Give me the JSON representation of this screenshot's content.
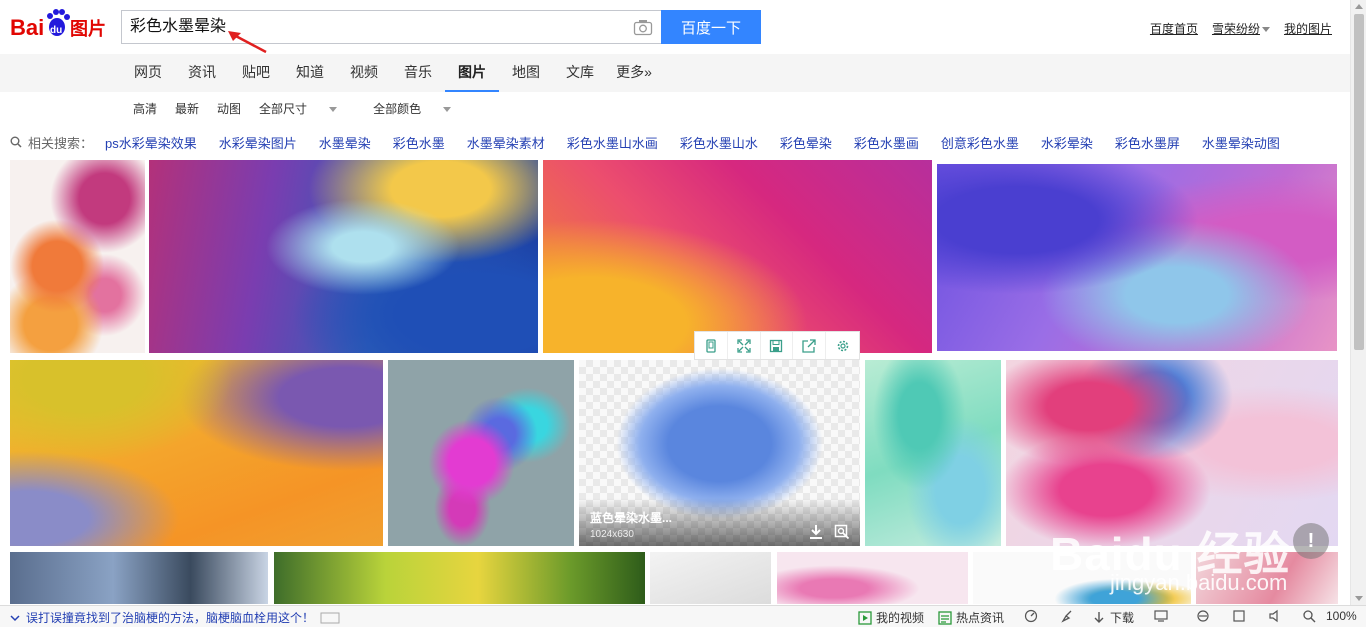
{
  "search": {
    "query": "彩色水墨晕染",
    "button_label": "百度一下"
  },
  "top_links": {
    "home": "百度首页",
    "user": "雪荣纷纷",
    "my_images": "我的图片"
  },
  "nav": {
    "tabs": [
      "网页",
      "资讯",
      "贴吧",
      "知道",
      "视频",
      "音乐",
      "图片",
      "地图",
      "文库",
      "更多»"
    ],
    "active": "图片"
  },
  "filters": {
    "hd": "高清",
    "latest": "最新",
    "animated": "动图",
    "all_sizes": "全部尺寸",
    "all_colors": "全部颜色"
  },
  "related": {
    "label": "相关搜索：",
    "terms": [
      "ps水彩晕染效果",
      "水彩晕染图片",
      "水墨晕染",
      "彩色水墨",
      "水墨晕染素材",
      "彩色水墨山水画",
      "彩色水墨山水",
      "彩色晕染",
      "彩色水墨画",
      "创意彩色水墨",
      "水彩晕染",
      "彩色水墨屏",
      "水墨晕染动图"
    ]
  },
  "hover_card": {
    "caption": "蓝色晕染水墨...",
    "dims": "1024x630"
  },
  "watermark": {
    "brand": "Baidu 经验",
    "url": "jingyan.baidu.com"
  },
  "status": {
    "news": "误打误撞竟找到了治脑梗的方法，脑梗脑血栓用这个！",
    "my_video": "我的视频",
    "hot_news": "热点资讯",
    "download": "下载",
    "zoom": "100%"
  },
  "colors": {
    "accent": "#3385ff",
    "link": "#2440b3",
    "logo_red": "#e10602",
    "logo_blue": "#2319dc"
  }
}
